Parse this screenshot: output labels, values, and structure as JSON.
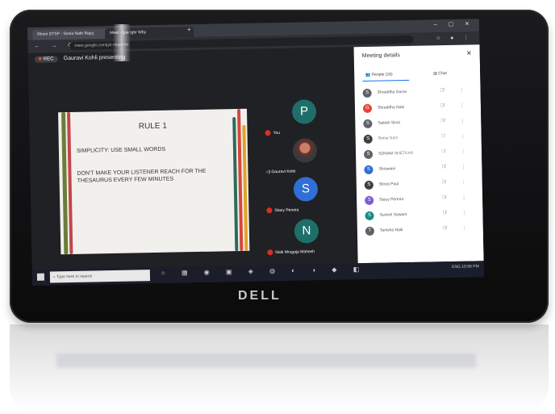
{
  "browser": {
    "tabs": [
      "Rhoni DTSP - Sonia Nath Rajuj",
      "Meet - Ijue Ighr Wby"
    ],
    "url": "meet.google.com/jyk-obqm-fkt"
  },
  "meet": {
    "rec_label": "REC",
    "presenter": "Gauravi Kohli presenting",
    "slide": {
      "title": "RULE 1",
      "bullets": [
        "SIMPLICITY: USE SMALL WORDS",
        "DON'T MAKE YOUR LISTENER REACH FOR THE THESAURUS EVERY FEW MINUTES"
      ]
    },
    "tiles": [
      {
        "initial": "P",
        "name": "You",
        "color": "#1e6f6a"
      },
      {
        "initial": "",
        "name": "Gauravi Kohli",
        "color": "#3a3a3a"
      },
      {
        "initial": "S",
        "name": "Stacy Pereira",
        "color": "#2f6fd6"
      },
      {
        "initial": "N",
        "name": "Naik Mrugaja Mahesh",
        "color": "#1e6f6a"
      }
    ]
  },
  "panel": {
    "title": "Meeting details",
    "tab_people": "People (16)",
    "tab_chat": "Chat",
    "people": [
      {
        "initial": "S",
        "name": "Shraddha Gurav",
        "color": "#5f6368"
      },
      {
        "initial": "G",
        "name": "Shraddha Naik",
        "color": "#ea4335"
      },
      {
        "initial": "S",
        "name": "Sakshi Sinai",
        "color": "#5f6368"
      },
      {
        "initial": "S",
        "name": "Sonia Nath",
        "color": "#3c4043"
      },
      {
        "initial": "S",
        "name": "SONAM SHETKAR",
        "color": "#5f6368"
      },
      {
        "initial": "S",
        "name": "Shrawani",
        "color": "#2f6fd6"
      },
      {
        "initial": "S",
        "name": "Shruti Paul",
        "color": "#3c4043"
      },
      {
        "initial": "S",
        "name": "Stacy Pereira",
        "color": "#7b5cd6"
      },
      {
        "initial": "S",
        "name": "Suresh Sawant",
        "color": "#1a8a8a"
      },
      {
        "initial": "T",
        "name": "Tanisha Naik",
        "color": "#5f6368"
      }
    ]
  },
  "taskbar": {
    "search_placeholder": "Type here to search",
    "tray_text": "ENG 19:56 PM"
  },
  "device": {
    "brand": "DELL"
  }
}
